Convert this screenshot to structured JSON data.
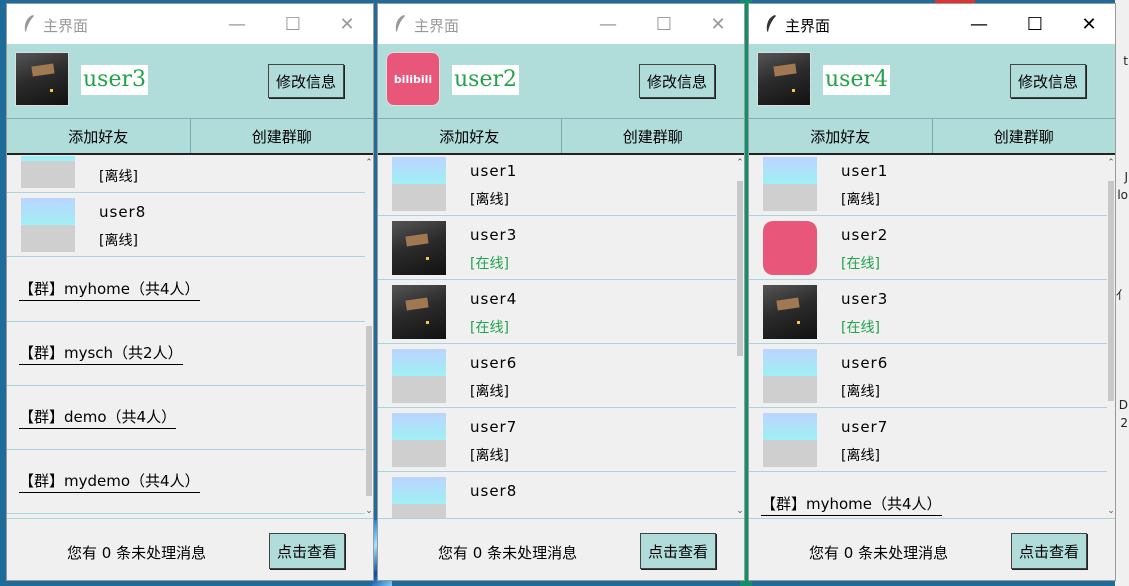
{
  "windows": [
    {
      "title": "主界面",
      "username": "user3",
      "avatar": "dark-photo",
      "edit_label": "修改信息",
      "add_friend_label": "添加好友",
      "create_group_label": "创建群聊",
      "rows": [
        {
          "kind": "friend",
          "name": "",
          "status": "[离线]",
          "online": false,
          "avatar": "gradient"
        },
        {
          "kind": "friend",
          "name": "user8",
          "status": "[离线]",
          "online": false,
          "avatar": "gradient"
        },
        {
          "kind": "group",
          "text": "【群】myhome（共4人）"
        },
        {
          "kind": "group",
          "text": "【群】mysch（共2人）"
        },
        {
          "kind": "group",
          "text": "【群】demo（共4人）"
        },
        {
          "kind": "group",
          "text": "【群】mydemo（共4人）"
        }
      ],
      "footer_text": "您有 0 条未处理消息",
      "view_label": "点击查看",
      "active": false
    },
    {
      "title": "主界面",
      "username": "user2",
      "avatar": "bilibili-logo",
      "avatar_text": "bilibili",
      "edit_label": "修改信息",
      "add_friend_label": "添加好友",
      "create_group_label": "创建群聊",
      "rows": [
        {
          "kind": "friend",
          "name": "user1",
          "status": "[离线]",
          "online": false,
          "avatar": "gradient"
        },
        {
          "kind": "friend",
          "name": "user3",
          "status": "[在线]",
          "online": true,
          "avatar": "dark-photo"
        },
        {
          "kind": "friend",
          "name": "user4",
          "status": "[在线]",
          "online": true,
          "avatar": "dark-photo"
        },
        {
          "kind": "friend",
          "name": "user6",
          "status": "[离线]",
          "online": false,
          "avatar": "gradient"
        },
        {
          "kind": "friend",
          "name": "user7",
          "status": "[离线]",
          "online": false,
          "avatar": "gradient"
        },
        {
          "kind": "friend",
          "name": "user8",
          "status": "",
          "online": false,
          "avatar": "gradient"
        }
      ],
      "footer_text": "您有 0 条未处理消息",
      "view_label": "点击查看",
      "active": false
    },
    {
      "title": "主界面",
      "username": "user4",
      "avatar": "dark-photo",
      "edit_label": "修改信息",
      "add_friend_label": "添加好友",
      "create_group_label": "创建群聊",
      "rows": [
        {
          "kind": "friend",
          "name": "user1",
          "status": "[离线]",
          "online": false,
          "avatar": "gradient"
        },
        {
          "kind": "friend",
          "name": "user2",
          "status": "[在线]",
          "online": true,
          "avatar": "bilibili-logo"
        },
        {
          "kind": "friend",
          "name": "user3",
          "status": "[在线]",
          "online": true,
          "avatar": "dark-photo"
        },
        {
          "kind": "friend",
          "name": "user6",
          "status": "[离线]",
          "online": false,
          "avatar": "gradient"
        },
        {
          "kind": "friend",
          "name": "user7",
          "status": "[离线]",
          "online": false,
          "avatar": "gradient"
        },
        {
          "kind": "group",
          "text": "【群】myhome（共4人）"
        }
      ],
      "footer_text": "您有 0 条未处理消息",
      "view_label": "点击查看",
      "active": true
    }
  ],
  "desktop_edge_glyphs": [
    "t",
    "J",
    "lo",
    "亻",
    "D",
    "2"
  ],
  "titlebar_icons": {
    "minimize": "—",
    "maximize": "☐",
    "close": "✕"
  }
}
